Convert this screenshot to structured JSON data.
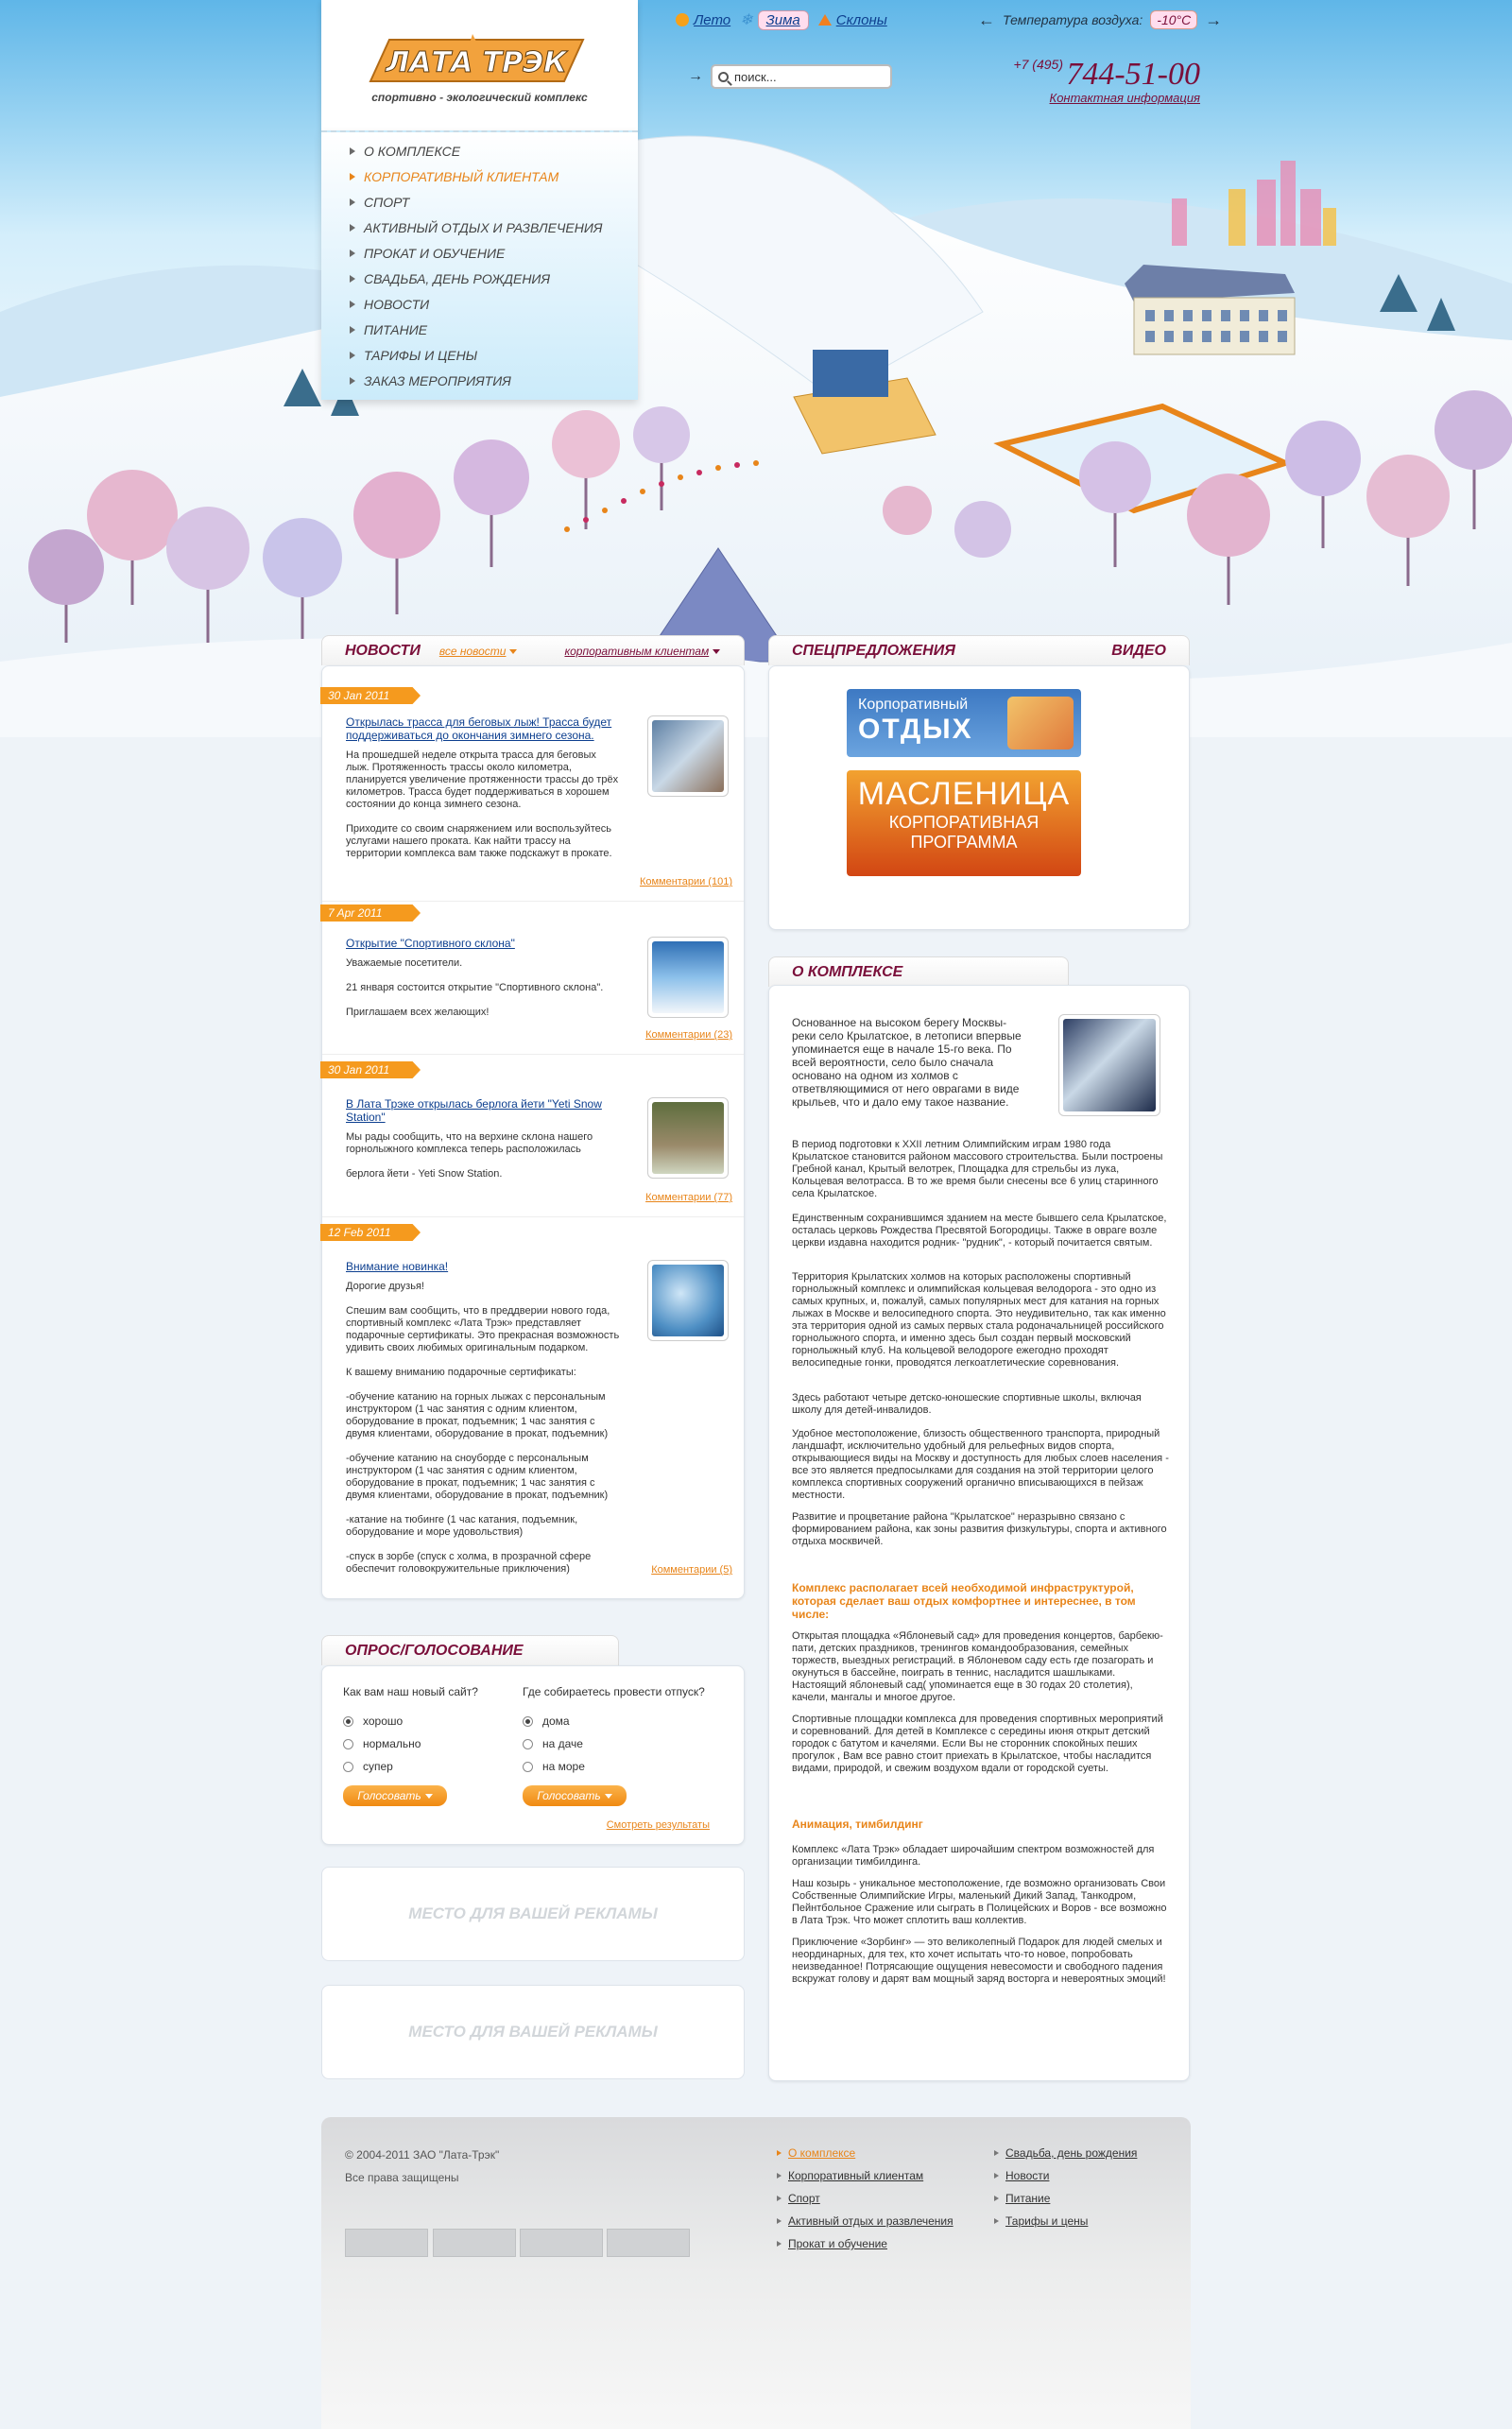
{
  "header": {
    "logo_text": "ЛАТА ТРЭК",
    "logo_subtitle": "спортивно - экологический комплекс",
    "seasons": [
      {
        "label": "Лето",
        "icon": "sun-icon"
      },
      {
        "label": "Зима",
        "icon": "snowflake-icon"
      },
      {
        "label": "Склоны",
        "icon": "slope-icon"
      }
    ],
    "temperature_label": "Температура воздуха:",
    "temperature_value": "-10°C",
    "search_placeholder": "поиск...",
    "phone_code": "+7 (495)",
    "phone_number": "744-51-00",
    "contact_link": "Контактная информация"
  },
  "nav": {
    "items": [
      {
        "label": "О комплексе"
      },
      {
        "label": "Корпоративный клиентам"
      },
      {
        "label": "Спорт"
      },
      {
        "label": "Активный отдых и развлечения"
      },
      {
        "label": "Прокат и обучение"
      },
      {
        "label": "Свадьба, день рождения"
      },
      {
        "label": "Новости"
      },
      {
        "label": "Питание"
      },
      {
        "label": "Тарифы и цены"
      },
      {
        "label": "Заказ мероприятия"
      }
    ]
  },
  "news": {
    "tab_title": "Новости",
    "filter_all": "все новости",
    "filter_corp": "корпоративным клиентам",
    "items": [
      {
        "date": "30 Jan 2011",
        "title": "Открылась трасса для беговых лыж! Трасса будет поддерживаться до окончания зимнего сезона.",
        "text": "На прошедшей неделе открыта трасса для беговых лыж. Протяженность трассы около километра, планируется увеличение протяженности трассы до трёх километров. Трасса будет поддерживаться в хорошем состоянии до конца зимнего сезона.\n\nПриходите со своим снаряжением или воспользуйтесь услугами нашего проката. Как найти трассу на территории комплекса вам также подскажут в прокате.",
        "comments": "Комментарии (101)"
      },
      {
        "date": "7 Apr 2011",
        "title": "Открытие \"Спортивного склона\"",
        "text": "Уважаемые посетители.\n\n21 января состоится открытие \"Спортивного склона\".\n\nПриглашаем всех желающих!",
        "comments": "Комментарии (23)"
      },
      {
        "date": "30 Jan 2011",
        "title": "В Лата Трэке открылась берлога йети \"Yeti Snow Station\"",
        "text": "Мы рады сообщить, что на верхине склона нашего горнолыжного комплекса теперь расположилась\n\nберлога йети - Yeti Snow Station.",
        "comments": "Комментарии (77)"
      },
      {
        "date": "12 Feb 2011",
        "title": "Внимание новинка!",
        "text": "Дорогие друзья!\n\nСпешим вам сообщить, что в преддверии нового года, спортивный комплекс «Лата Трэк» представляет подарочные сертификаты. Это прекрасная возможность удивить своих любимых оригинальным подарком.\n\nК вашему вниманию подарочные сертификаты:\n\n-обучение катанию на горных лыжах с персональным инструктором (1 час занятия с одним клиентом, оборудование в прокат, подъемник; 1 час занятия с двумя клиентами, оборудование в прокат, подъемник)\n\n-обучение катанию на сноуборде с персональным инструктором (1 час занятия с одним клиентом, оборудование в прокат, подъемник; 1 час занятия с двумя клиентами, оборудование в прокат, подъемник)\n\n-катание на тюбинге (1 час катания, подъемник, оборудование и море удовольствия)\n\n-спуск в зорбе (спуск с холма, в прозрачной сфере обеспечит головокружительные приключения)",
        "comments": "Комментарии (5)"
      }
    ]
  },
  "poll": {
    "tab_title": "Опрос/Голосование",
    "q1": "Как вам наш новый сайт?",
    "q1_options": [
      "хорошо",
      "нормально",
      "супер"
    ],
    "q2": "Где собираетесь провести отпуск?",
    "q2_options": [
      "дома",
      "на даче",
      "на море"
    ],
    "vote_label": "Голосовать",
    "results_link": "Смотреть результаты"
  },
  "ads": {
    "placeholder": "МЕСТО ДЛЯ ВАШЕЙ РЕКЛАМЫ"
  },
  "specials": {
    "tab_title": "Спецпредложения",
    "video_tab": "Видео",
    "banner1_line1": "Корпоративный",
    "banner1_line2": "ОТДЫХ",
    "banner2_line1": "МАСЛЕНИЦА",
    "banner2_line2": "КОРПОРАТИВНАЯ",
    "banner2_line3": "ПРОГРАММА"
  },
  "about": {
    "tab_title": "О комплексе",
    "intro": "Основанное на высоком берегу Москвы-реки село Крылатское, в летописи впервые упоминается еще в начале 15-го века. По всей вероятности, село было сначала основано на одном из холмов с ответвляющимися от него оврагами в виде крыльев, что и дало ему такое название.",
    "p1": "В период подготовки к XXII летним Олимпийским играм 1980 года Крылатское становится районом массового строительства. Были построены Гребной канал, Крытый велотрек, Площадка для стрельбы из лука, Кольцевая велотрасса. В то же время были снесены все 6 улиц старинного села Крылатское.",
    "p2": "Единственным сохранившимся зданием на месте бывшего села Крылатское, осталась церковь Рождества Пресвятой Богородицы. Также в овраге возле церкви издавна находится родник- \"рудник\", - который почитается святым.",
    "p3": "Территория Крылатских холмов на которых расположены спортивный горнолыжный комплекс и олимпийская кольцевая велодорога - это одно из самых крупных, и, пожалуй, самых популярных мест для катания на горных лыжах в Москве и велосипедного спорта. Это неудивительно, так как именно эта территория одной из самых первых стала родоначальницей российского горнолыжного спорта, и именно здесь был создан первый московский горнолыжный клуб. На кольцевой велодороге ежегодно проходят велосипедные гонки, проводятся легкоатлетические соревнования.",
    "p4": "Здесь работают четыре детско-юношеские спортивные школы, включая школу для детей-инвалидов.",
    "p5": "Удобное местоположение, близость общественного транспорта, природный ландшафт, исключительно удобный для рельефных видов спорта, открывающиеся виды на Москву и доступность для любых слоев населения - все это является предпосылками для создания на этой территории целого комплекса спортивных сооружений органично вписывающихся в пейзаж местности.",
    "p6": "Развитие и процветание района \"Крылатское\" неразрывно связано с формированием района, как зоны развития физкультуры, спорта и активного отдыха москвичей.",
    "head1": "Комплекс располагает всей необходимой инфраструктурой, которая сделает ваш отдых комфортнее и интереснее, в том числе:",
    "p7": "Открытая площадка «Яблоневый сад» для проведения концертов, барбекю-пати, детских праздников, тренингов командообразования, семейных торжеств, выездных регистраций. в Яблоневом саду есть где позагорать и окунуться в бассейне, поиграть в теннис, насладится шашлыками. Настоящий яблоневый сад( упоминается еще в 30 годах 20 столетия), качели, мангалы и многое другое.",
    "p8": "Спортивные площадки комплекса для проведения спортивных мероприятий и соревнований. Для детей в Комплексе с середины июня открыт детский городок с батутом и качелями. Если Вы не сторонник спокойных пеших прогулок , Вам все равно стоит приехать в Крылатское, чтобы насладится видами, природой, и свежим воздухом вдали от городской суеты.",
    "head2": "Анимация, тимбилдинг",
    "p9": "Комплекс «Лата Трэк» обладает широчайшим спектром возможностей для организации тимбилдинга.",
    "p10": "Наш козырь - уникальное местоположение, где возможно организовать Свои Собственные Олимпийские Игры, маленький Дикий Запад, Танкодром, Пейнтбольное Сражение или сыграть в Полицейских и Воров - все возможно в Лата Трэк. Что может сплотить ваш коллектив.",
    "p11": "Приключение «Зорбинг» — это великолепный Подарок для людей смелых и неординарных, для тех, кто хочет испытать что-то новое, попробовать неизведанное! Потрясающие ощущения невесомости и свободного падения вскружат голову и дарят вам мощный заряд восторга и невероятных эмоций!"
  },
  "footer": {
    "copyright": "© 2004-2011 ЗАО \"Лата-Трэк\"",
    "rights": "Все права защищены",
    "col1": [
      "О комплексе",
      "Корпоративный клиентам",
      "Спорт",
      "Активный отдых и развлечения",
      "Прокат и обучение"
    ],
    "col2": [
      "Свадьба, день рождения",
      "Новости",
      "Питание",
      "Тарифы и цены"
    ]
  },
  "colors": {
    "accent": "#e8851a",
    "brand": "#7a0f3a",
    "link": "#0d3f8f"
  }
}
